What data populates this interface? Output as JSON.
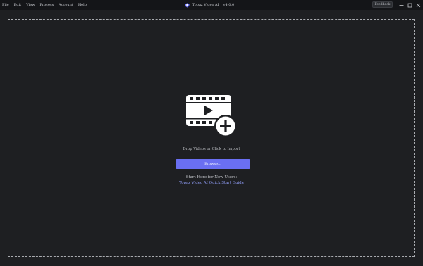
{
  "menu": {
    "items": [
      {
        "label": "File"
      },
      {
        "label": "Edit"
      },
      {
        "label": "View"
      },
      {
        "label": "Process"
      },
      {
        "label": "Account"
      },
      {
        "label": "Help"
      }
    ]
  },
  "window": {
    "title": "Topaz Video AI",
    "version": "v4.0.0",
    "feedback_label": "Feedback",
    "icons": [
      "topaz-logo-icon",
      "minimize-icon",
      "maximize-icon",
      "close-icon"
    ]
  },
  "dropzone": {
    "icon": "video-add-icon",
    "prompt": "Drop Videos or Click to Import",
    "browse_label": "Browse...",
    "guide_heading": "Start Here for New Users:",
    "guide_link": "Topaz Video AI Quick Start Guide"
  },
  "colors": {
    "background": "#1e1f22",
    "titlebar": "#141518",
    "accent": "#6a6ff2",
    "link": "#8f9cf5",
    "dash_border": "#a9abb0"
  }
}
